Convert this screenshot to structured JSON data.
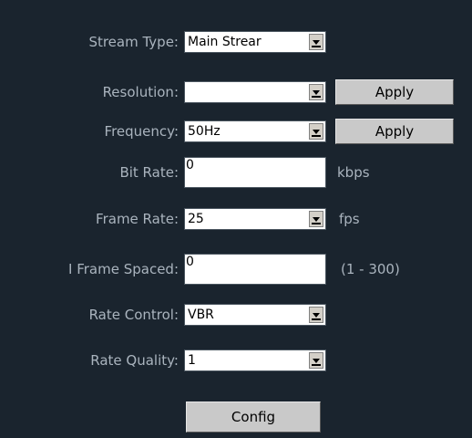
{
  "form": {
    "stream_type": {
      "label": "Stream Type:",
      "value": "Main Strear"
    },
    "resolution": {
      "label": "Resolution:",
      "value": "",
      "apply_label": "Apply"
    },
    "frequency": {
      "label": "Frequency:",
      "value": "50Hz",
      "apply_label": "Apply"
    },
    "bit_rate": {
      "label": "Bit Rate:",
      "value": "0",
      "unit": "kbps"
    },
    "frame_rate": {
      "label": "Frame Rate:",
      "value": "25",
      "unit": "fps"
    },
    "i_frame_spaced": {
      "label": "I Frame Spaced:",
      "value": "0",
      "range": "(1 - 300)"
    },
    "rate_control": {
      "label": "Rate Control:",
      "value": "VBR"
    },
    "rate_quality": {
      "label": "Rate Quality:",
      "value": "1"
    },
    "config_label": "Config"
  },
  "colors": {
    "background": "#1a242e",
    "label_text": "#aab4be",
    "button_face": "#c9c9c9"
  }
}
